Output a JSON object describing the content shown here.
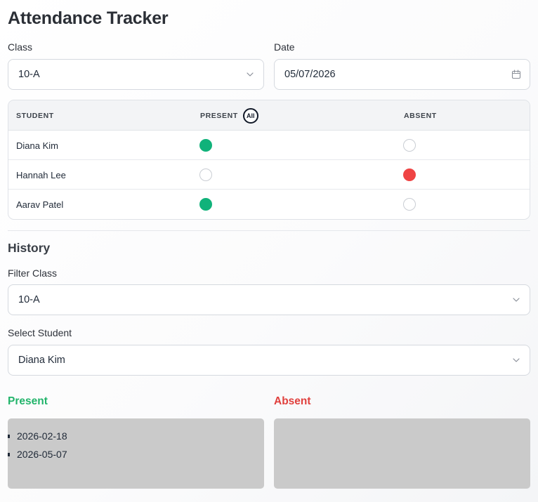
{
  "app": {
    "title": "Attendance Tracker"
  },
  "form": {
    "class_label": "Class",
    "class_value": "10-A",
    "date_label": "Date",
    "date_value": "05/07/2026"
  },
  "table": {
    "headers": {
      "student": "STUDENT",
      "present": "PRESENT",
      "all_button": "All",
      "absent": "ABSENT"
    },
    "rows": [
      {
        "name": "Diana Kim",
        "status": "present"
      },
      {
        "name": "Hannah Lee",
        "status": "absent"
      },
      {
        "name": "Aarav Patel",
        "status": "present"
      }
    ]
  },
  "history": {
    "title": "History",
    "filter_class_label": "Filter Class",
    "filter_class_value": "10-A",
    "select_student_label": "Select Student",
    "select_student_value": "Diana Kim",
    "present_title": "Present",
    "absent_title": "Absent",
    "present_dates": [
      "2026-02-18",
      "2026-05-07"
    ],
    "absent_dates": []
  },
  "colors": {
    "present": "#10b27a",
    "absent": "#ef4444",
    "present_heading": "#22b46b",
    "absent_heading": "#e0403d"
  },
  "icons": {
    "class_select": "chevron-down-icon",
    "date_picker": "calendar-icon",
    "filter_select": "chevron-down-icon",
    "student_select": "chevron-down-icon"
  }
}
